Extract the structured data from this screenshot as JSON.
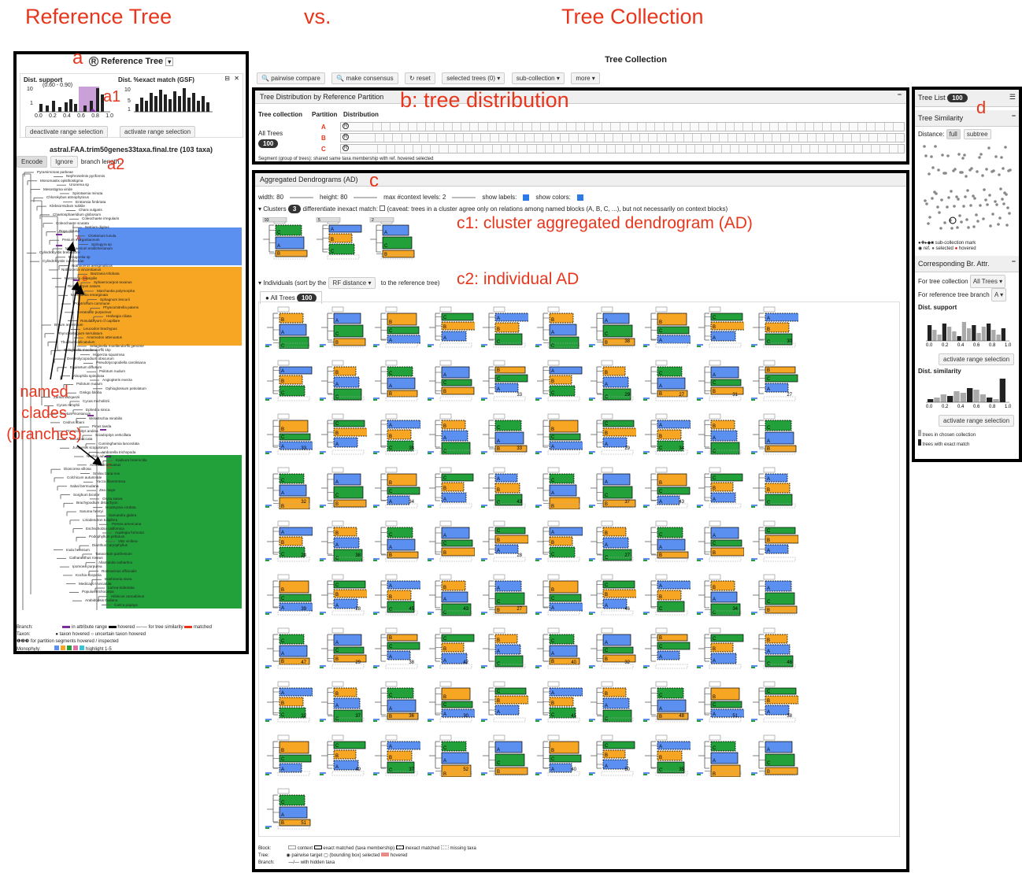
{
  "annotations": {
    "reference_tree": "Reference Tree",
    "vs": "vs.",
    "tree_collection": "Tree Collection",
    "a": "a",
    "a1": "a1",
    "a2": "a2",
    "b": "b: tree distribution",
    "c": "c",
    "c1": "c1: cluster aggregated dendrogram (AD)",
    "c2": "c2: individual AD",
    "d": "d",
    "named_clades": "named\nclades\n(branches)",
    "named1": "named",
    "named2": "clades",
    "named3": "(branches)"
  },
  "left": {
    "title": "Reference Tree",
    "dist_support": "Dist. support",
    "dist_support_range": "(0.60 - 0.90)",
    "dist_exact": "Dist. %exact match (GSF)",
    "deactivate_btn": "deactivate range selection",
    "activate_btn": "activate range selection",
    "tree_name": "astral.FAA.trim50genes33taxa.final.tre (103 taxa)",
    "encode": "Encode",
    "ignore": "Ignore",
    "branch_length": "branch length.",
    "axis_support": [
      "0.0",
      "0.2",
      "0.4",
      "0.6",
      "0.8",
      "1.0"
    ],
    "yticks_support": [
      "10",
      "1"
    ],
    "yticks_exact": [
      "10",
      "5",
      "1"
    ],
    "label_A": "A",
    "label_B": "B",
    "label_C": "C",
    "legend": {
      "branch": "Branch:",
      "in_range": "in attribute range",
      "hovered": "hovered",
      "for_similarity": "for tree similarity",
      "matched": "matched",
      "taxon": "Taxon:",
      "taxon_hovered": "taxon hovered",
      "uncertain": "uncertain taxon hovered",
      "partition": "for partition segments hovered / inspected",
      "monophyly": "Monophyly:",
      "highlight": "highlight 1-5"
    },
    "taxa": [
      "Pyramimonas parkeae",
      "Nephroselmis pyriformis",
      "Monomastix opisthostigma",
      "Uronema sp",
      "Mesostigma viride",
      "Spirotaenia minuta",
      "Chlorokybus atmophyticus",
      "Entransia fimbriata",
      "Klebsormidium subtile",
      "Chara vulgaris",
      "Chaetosphaeridium globosum",
      "Coleochaete irregularis",
      "Coleochaete scutata",
      "Netrium digitus",
      "Roya obtusa",
      "Closterium lunula",
      "Penium margaritaceum",
      "Spirogyra sp",
      "Mesotaenium endlicherianum",
      "Cylindrocystis brebissonii",
      "Mougeotia sp",
      "Cylindrocystis cushleckae",
      "Nothoceros aenigmaticus",
      "Nothoceros vincentianus",
      "Bazzania trilobata",
      "Metzgeria crassipilis",
      "Sphaerocarpos texanus",
      "Ricciocarpos natans",
      "Marchantia polymorpha",
      "Marchantia emarginata",
      "Sphagnum lescurii",
      "Polytrichum commune",
      "Physcomitrella patens",
      "Ceratodon purpureus",
      "Hedwigia ciliata",
      "Rosulabryum cf capillare",
      "Bryum argenteum",
      "Leucodon brachypus",
      "Rhynchostegium serrulatum",
      "Anomodon attenuatus",
      "Thuidium delicatulum",
      "Selaginella moellendorffii genome",
      "Selaginella moellendorffii 1kp",
      "Huperzia squarrosa",
      "Dendrolycopodium obscurum",
      "Pseudolycopodiella caroliniana",
      "Equisetum diffusum",
      "Psilotum nudum",
      "Alsophila spinulosa",
      "Angiopteris evecta",
      "Psilotum nudum",
      "Ophioglossum petiolatum",
      "Ginkgo biloba",
      "Zamia vazquezii",
      "Cycas micholitzii",
      "Cycas rumphii",
      "Ephedra sinica",
      "Gnetum montanum",
      "Welwitschia mirabilis",
      "Cedrus libani",
      "Pinus taeda",
      "Prumnopitys andina",
      "Sciadopitys verticillata",
      "Taxus baccata",
      "Cunninghamia lanceolata",
      "Juniperus scopulorum",
      "Amborella trichopoda",
      "Nuphar advena",
      "Kadsura heteroclita",
      "Acorus americanus",
      "Dioscorea villosa",
      "Smilax bona-nox",
      "Colchicum autumnale",
      "Yucca filamentosa",
      "Sabal bermudana",
      "Zea mays",
      "Sorghum bicolor",
      "Oryza sativa",
      "Brachypodium distachyon",
      "Houttuynia cordata",
      "Saruma henryi",
      "Sarcandra glabra",
      "Liriodendron tulipifera",
      "Persea americana",
      "Eschscholzia californica",
      "Aquilegia formosa",
      "Podophyllum peltatum",
      "Vitis vinifera",
      "Dianthus caryophyllus",
      "Inula helenium",
      "Tanacetum parthenium",
      "Catharanthus roseus",
      "Allamanda cathartica",
      "Ipomoea purpurea",
      "Rosmarinus officinalis",
      "Kochia scoparia",
      "Boehmeria nivea",
      "Medicago truncatula",
      "Larrea tridentata",
      "Populus trichocarpa",
      "Hibiscus cannabinus",
      "Arabidopsis thaliana",
      "Carica papaya"
    ]
  },
  "top": {
    "title": "Tree Collection",
    "buttons": [
      "pairwise compare",
      "make consensus",
      "reset",
      "selected trees (0)",
      "sub-collection",
      "more"
    ]
  },
  "dist": {
    "title": "Tree Distribution by Reference Partition",
    "col_collection": "Tree collection",
    "col_partition": "Partition",
    "col_distribution": "Distribution",
    "row_label": "All Trees",
    "row_count": "100",
    "partitions": [
      "A",
      "B",
      "C"
    ],
    "legend": "Segment (group of trees):  shared same taxa membership with ref.       hovered       selected"
  },
  "ad": {
    "title": "Aggregated Dendrograms (AD)",
    "width": "width: 80",
    "height": "height: 80",
    "max_ctx": "max #context levels: 2",
    "show_labels": "show labels:",
    "show_colors": "show colors:",
    "clusters": "Clusters",
    "clusters_count": "3",
    "differentiate": "differentiate inexact match:",
    "caveat": "(caveat: trees in a cluster agree only on relations among named blocks (A, B, C, ...), but not necessarily on context blocks)",
    "cluster_counts": [
      "93",
      "5",
      "2"
    ],
    "individuals": "Individuals",
    "sort_by": "(sort by the",
    "rf": "RF distance",
    "to_ref": "to the reference tree)",
    "tab_all": "All Trees",
    "tab_count": "100",
    "legend_block": "Block:",
    "legend_context": "context",
    "legend_exact": "exact matched (taxa membership)",
    "legend_inexact": "inexact matched",
    "legend_missing": "missing taxa",
    "legend_tree": "Tree:",
    "legend_pair": "pairwise target",
    "legend_bbox": "(bounding box) selected",
    "legend_hovered": "hovered",
    "legend_branch": "Branch:",
    "legend_hidden": "with hidden taxa",
    "counts": [
      "",
      "",
      "",
      "",
      "",
      "",
      "",
      "",
      "",
      "",
      "38",
      "",
      "",
      "",
      "30",
      "27",
      "",
      "",
      "33",
      "",
      "29",
      "27",
      "",
      "29",
      "31",
      "",
      "33",
      "35",
      "",
      "33",
      "29",
      "34",
      "",
      "",
      "27",
      "",
      "",
      "",
      "",
      "",
      "",
      "43",
      "",
      "",
      "37",
      "43",
      "",
      "38",
      "",
      "",
      "",
      "",
      "",
      "28",
      "27",
      "",
      "",
      "",
      "",
      "",
      "",
      "",
      "",
      "",
      "",
      "",
      "",
      "46",
      "",
      "",
      "",
      "",
      "",
      "",
      "",
      "",
      "",
      "46",
      "",
      "",
      "",
      "",
      "",
      "",
      "",
      "",
      "",
      "",
      "",
      "",
      "",
      "",
      "",
      "",
      "",
      "",
      "",
      "",
      "",
      "",
      "",
      "",
      "51"
    ],
    "tile_counts": [
      [
        "",
        "",
        "",
        "",
        "",
        "",
        "38",
        "",
        "",
        "30"
      ],
      [
        "",
        "",
        "",
        "",
        "33",
        "",
        "29",
        "27",
        "31",
        "27"
      ],
      [
        "33",
        "",
        "35",
        "",
        "33",
        "",
        "29",
        "34",
        "",
        ""
      ],
      [
        "32",
        "",
        "34",
        "",
        "43",
        "",
        "37",
        "43",
        "",
        ""
      ],
      [
        "28",
        "38",
        "",
        "",
        "28",
        "",
        "27",
        "",
        "",
        ""
      ],
      [
        "39",
        "28",
        "45",
        "43",
        "27",
        "",
        "46",
        "",
        "34",
        ""
      ],
      [
        "47",
        "29",
        "38",
        "42",
        "",
        "40",
        "32",
        "",
        "",
        "46"
      ],
      [
        "32",
        "37",
        "36",
        "30",
        "",
        "41",
        "",
        "48",
        "51",
        "38"
      ],
      [
        "",
        "49",
        "37",
        "52",
        "",
        "40",
        "50",
        "35",
        "",
        ""
      ],
      [
        "51"
      ]
    ]
  },
  "right": {
    "tree_list": "Tree List",
    "tree_list_count": "100",
    "similarity": "Tree Similarity",
    "distance": "Distance:",
    "full": "full",
    "subtree": "subtree",
    "submark": "sub-collection mark",
    "ref": "ref.",
    "selected": "selected",
    "hovered": "hovered",
    "corr": "Corresponding Br. Attr.",
    "for_collection": "For tree collection",
    "all_trees": "All Trees",
    "for_branch": "For reference tree branch",
    "branch_val": "A",
    "dist_support": "Dist. support",
    "activate1": "activate range selection",
    "dist_similarity": "Dist. similarity",
    "activate2": "activate range selection",
    "legend1": "trees in chosen collection",
    "legend2": "trees with exact match",
    "axis": [
      "0.0",
      "0.2",
      "0.4",
      "0.6",
      "0.8",
      "1.0"
    ],
    "yt_top": "10",
    "yt_bot": "1"
  }
}
